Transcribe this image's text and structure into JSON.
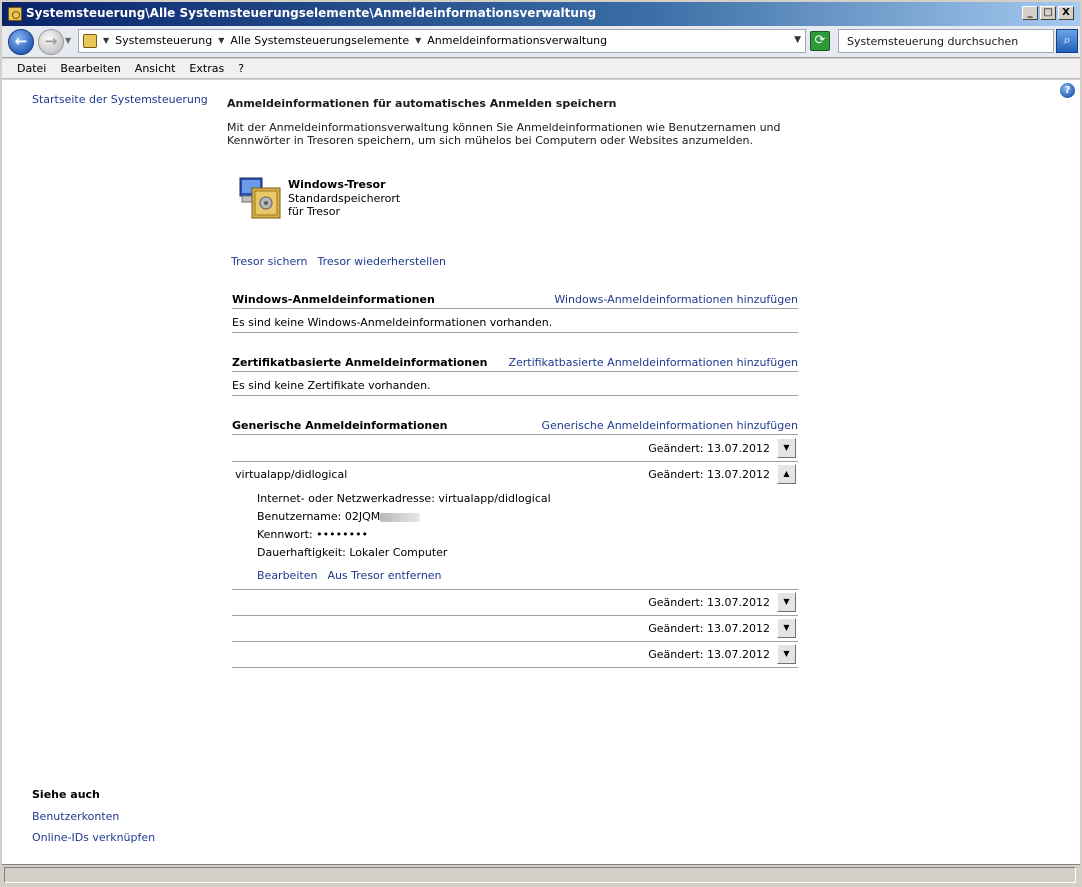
{
  "window": {
    "title": "Systemsteuerung\\Alle Systemsteuerungselemente\\Anmeldeinformationsverwaltung",
    "minimize": "_",
    "maximize": "□",
    "close": "X"
  },
  "address": {
    "crumbs": [
      "Systemsteuerung",
      "Alle Systemsteuerungselemente",
      "Anmeldeinformationsverwaltung"
    ],
    "search_placeholder": "Systemsteuerung durchsuchen"
  },
  "menu": [
    "Datei",
    "Bearbeiten",
    "Ansicht",
    "Extras",
    "?"
  ],
  "sidebar": {
    "home_link": "Startseite der Systemsteuerung",
    "see_also_title": "Siehe auch",
    "see_also": [
      "Benutzerkonten",
      "Online-IDs verknüpfen"
    ]
  },
  "main": {
    "title": "Anmeldeinformationen für automatisches Anmelden speichern",
    "description": "Mit der Anmeldeinformationsverwaltung können Sie Anmeldeinformationen wie Benutzernamen und Kennwörter in Tresoren speichern, um sich mühelos bei Computern oder Websites anzumelden.",
    "vault": {
      "title": "Windows-Tresor",
      "subtitle": "Standardspeicherort für Tresor"
    },
    "vault_links": {
      "backup": "Tresor sichern",
      "restore": "Tresor wiederherstellen"
    },
    "sections": {
      "windows": {
        "title": "Windows-Anmeldeinformationen",
        "add": "Windows-Anmeldeinformationen hinzufügen",
        "empty": "Es sind keine Windows-Anmeldeinformationen vorhanden."
      },
      "cert": {
        "title": "Zertifikatbasierte Anmeldeinformationen",
        "add": "Zertifikatbasierte Anmeldeinformationen hinzufügen",
        "empty": "Es sind keine Zertifikate vorhanden."
      },
      "generic": {
        "title": "Generische Anmeldeinformationen",
        "add": "Generische Anmeldeinformationen hinzufügen"
      }
    },
    "generic_entries": [
      {
        "name": "",
        "date": "Geändert:  13.07.2012"
      },
      {
        "name": "virtualapp/didlogical",
        "date": "Geändert:  13.07.2012"
      },
      {
        "name": "",
        "date": "Geändert:  13.07.2012"
      },
      {
        "name": "",
        "date": "Geändert:  13.07.2012"
      },
      {
        "name": "",
        "date": "Geändert:  13.07.2012"
      }
    ],
    "detail": {
      "address": "Internet- oder Netzwerkadresse:  virtualapp/didlogical",
      "username": "Benutzername:  02JQM",
      "password": "Kennwort:  ••••••••",
      "persistence": "Dauerhaftigkeit:  Lokaler Computer",
      "edit": "Bearbeiten",
      "remove": "Aus Tresor entfernen"
    }
  },
  "colors": {
    "link": "#1f3a8e",
    "title_bar": "#0a246a",
    "separator": "#a0a0a0"
  }
}
